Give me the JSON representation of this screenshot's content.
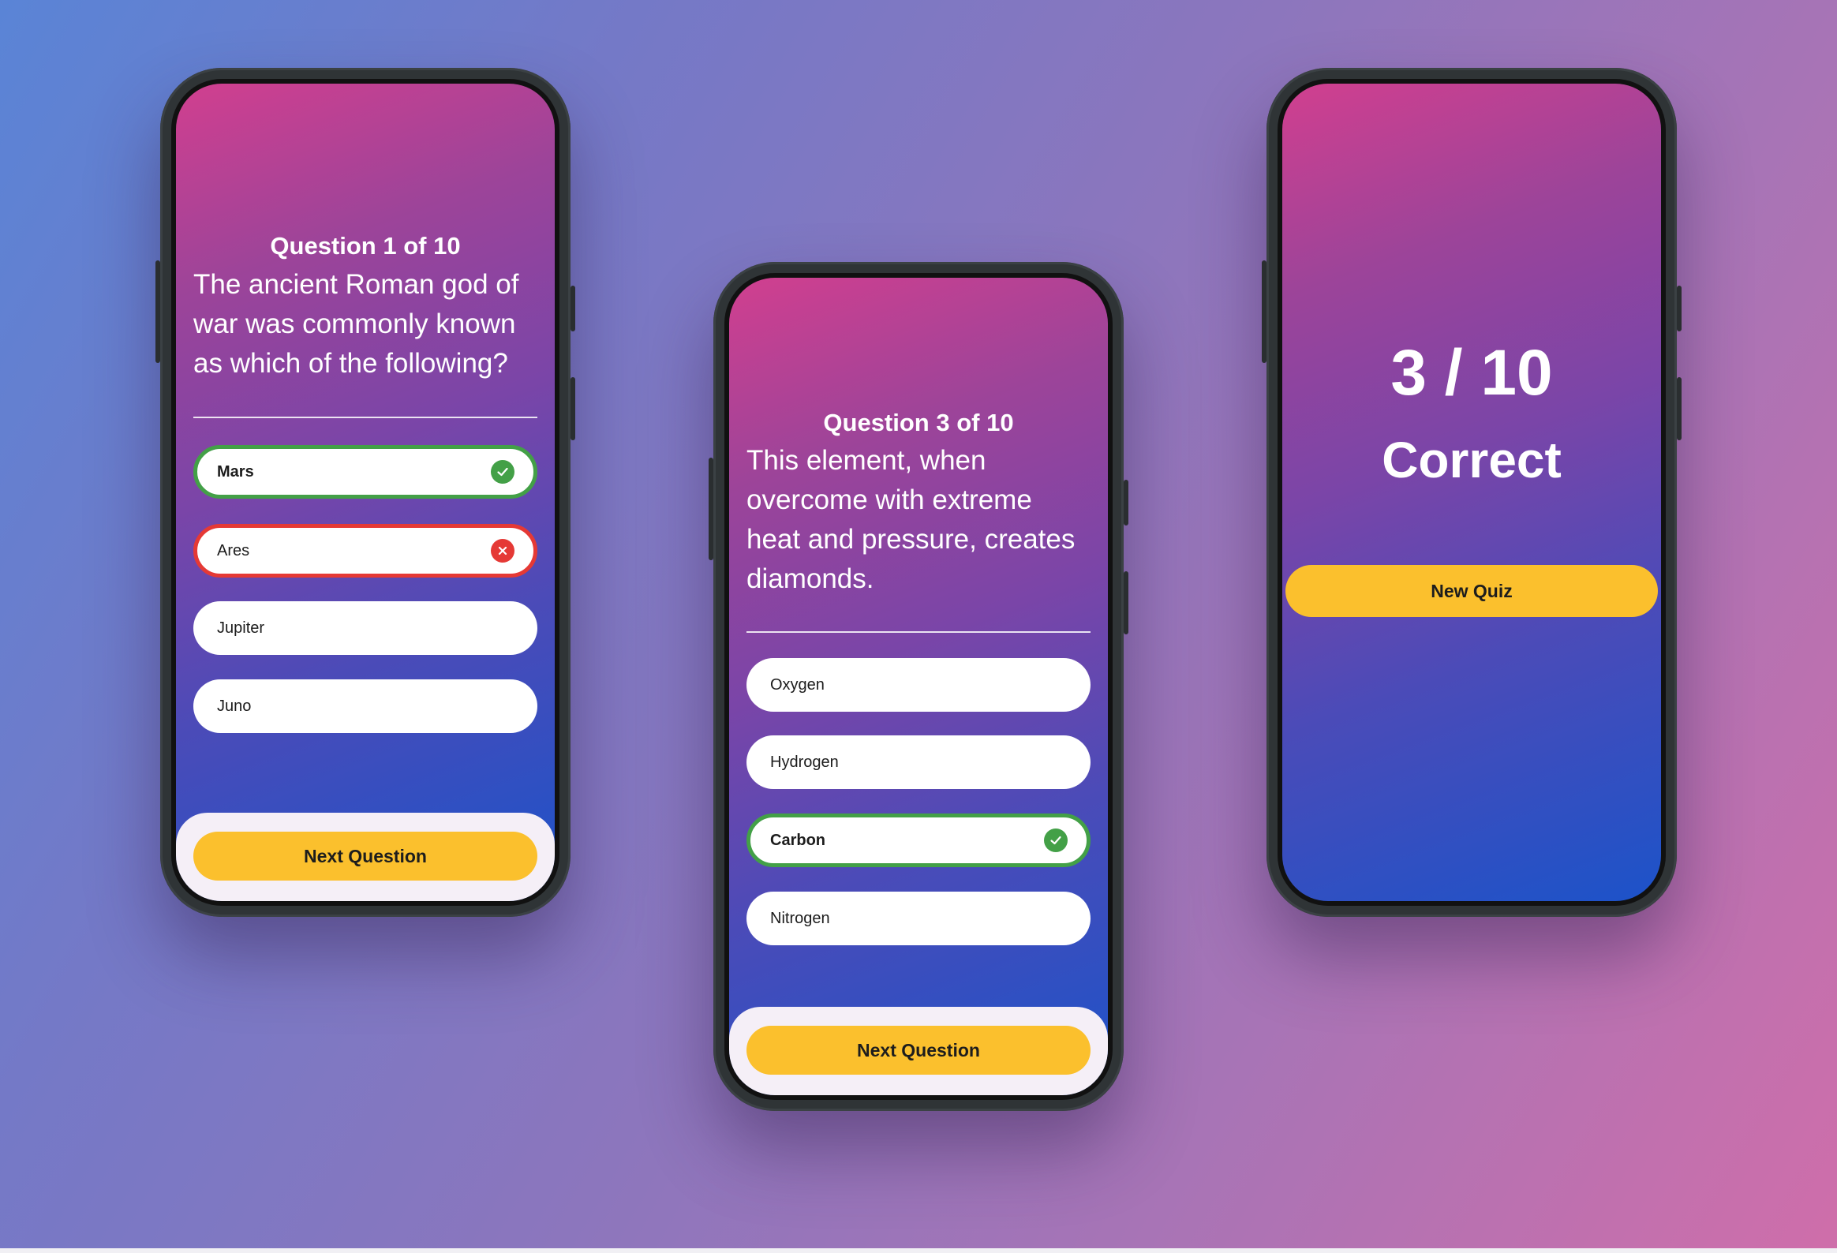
{
  "screens": {
    "question1": {
      "progress": "Question 1 of 10",
      "question": "The ancient Roman god of war was commonly known as which of the following?",
      "answers": [
        {
          "label": "Mars",
          "state": "correct"
        },
        {
          "label": "Ares",
          "state": "wrong"
        },
        {
          "label": "Jupiter",
          "state": "none"
        },
        {
          "label": "Juno",
          "state": "none"
        }
      ],
      "next_label": "Next Question"
    },
    "question3": {
      "progress": "Question 3 of 10",
      "question": "This element, when overcome with extreme heat and pressure, creates diamonds.",
      "answers": [
        {
          "label": "Oxygen",
          "state": "none"
        },
        {
          "label": "Hydrogen",
          "state": "none"
        },
        {
          "label": "Carbon",
          "state": "correct"
        },
        {
          "label": "Nitrogen",
          "state": "none"
        }
      ],
      "next_label": "Next Question"
    },
    "result": {
      "score": "3 / 10",
      "score_label": "Correct",
      "new_quiz_label": "New Quiz"
    }
  },
  "icons": {
    "correct": "check-circle-icon",
    "wrong": "close-circle-icon"
  },
  "colors": {
    "correct": "#43a047",
    "wrong": "#e53935",
    "accent": "#fbc02d",
    "gradient_start": "#d13f8f",
    "gradient_end": "#1c53c9"
  }
}
